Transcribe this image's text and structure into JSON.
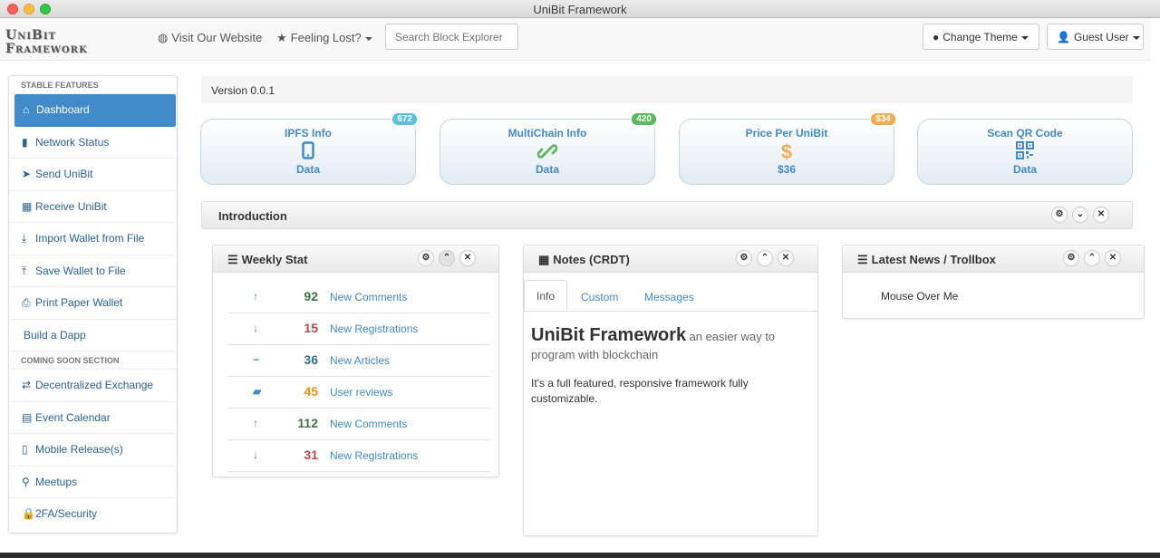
{
  "window": {
    "title": "UniBit Framework"
  },
  "brand": {
    "line1": "UniBit",
    "line2": "Framework"
  },
  "navbar": {
    "visit_site": "Visit Our Website",
    "feeling_lost": "Feeling Lost?",
    "search_placeholder": "Search Block Explorer",
    "change_theme": "Change Theme",
    "guest_user": "Guest User"
  },
  "sidebar": {
    "stable_header": "STABLE FEATURES",
    "stable_items": [
      {
        "label": "Dashboard",
        "icon": "home-icon"
      },
      {
        "label": "Network Status",
        "icon": "bar-chart-icon"
      },
      {
        "label": "Send UniBit",
        "icon": "send-icon"
      },
      {
        "label": "Receive UniBit",
        "icon": "qrcode-icon"
      },
      {
        "label": "Import Wallet from File",
        "icon": "import-icon"
      },
      {
        "label": "Save Wallet to File",
        "icon": "save-icon"
      },
      {
        "label": "Print Paper Wallet",
        "icon": "print-icon"
      },
      {
        "label": "Build a Dapp",
        "icon": ""
      }
    ],
    "soon_header": "COMING SOON SECTION",
    "soon_items": [
      {
        "label": "Decentralized Exchange",
        "icon": "transfer-icon"
      },
      {
        "label": "Event Calendar",
        "icon": "calendar-icon"
      },
      {
        "label": "Mobile Release(s)",
        "icon": "phone-icon"
      },
      {
        "label": "Meetups",
        "icon": "map-marker-icon"
      },
      {
        "label": "2FA/Security",
        "icon": "lock-icon"
      }
    ]
  },
  "version": "Version 0.0.1",
  "cards": [
    {
      "title": "IPFS Info",
      "value": "Data",
      "badge": "672",
      "badge_color": "#5bc0de",
      "icon": "phone-icon"
    },
    {
      "title": "MultiChain Info",
      "value": "Data",
      "badge": "420",
      "badge_color": "#5cb85c",
      "icon": "link-icon"
    },
    {
      "title": "Price Per UniBit",
      "value": "$36",
      "badge": "$34",
      "badge_color": "#f0ad4e",
      "icon": "dollar-icon"
    },
    {
      "title": "Scan QR Code",
      "value": "Data",
      "badge": "",
      "badge_color": "",
      "icon": "qrcode-icon"
    }
  ],
  "intro": {
    "title": "Introduction"
  },
  "weekly": {
    "title": "Weekly Stat",
    "rows": [
      {
        "count": "92",
        "label": "New Comments",
        "arrow": "up-arrow-icon",
        "color": "#3c763d"
      },
      {
        "count": "15",
        "label": "New Registrations",
        "arrow": "down-arrow-icon",
        "color": "#b94a48"
      },
      {
        "count": "36",
        "label": "New Articles",
        "arrow": "minus-icon",
        "color": "#31708f"
      },
      {
        "count": "45",
        "label": "User reviews",
        "arrow": "comment-icon",
        "color": "#f89406"
      },
      {
        "count": "112",
        "label": "New Comments",
        "arrow": "up-arrow-icon",
        "color": "#3c763d"
      },
      {
        "count": "31",
        "label": "New Registrations",
        "arrow": "down-arrow-icon",
        "color": "#b94a48"
      }
    ]
  },
  "notes": {
    "title": "Notes (CRDT)",
    "tabs": [
      "Info",
      "Custom",
      "Messages"
    ],
    "heading": "UniBit Framework",
    "heading_sub": "an easier way to program with blockchain",
    "body": "It's a full featured, responsive framework fully customizable."
  },
  "news": {
    "title": "Latest News / Trollbox",
    "body": "Mouse Over Me"
  },
  "colors": {
    "accent": "#428bca",
    "up": "#428bca"
  }
}
